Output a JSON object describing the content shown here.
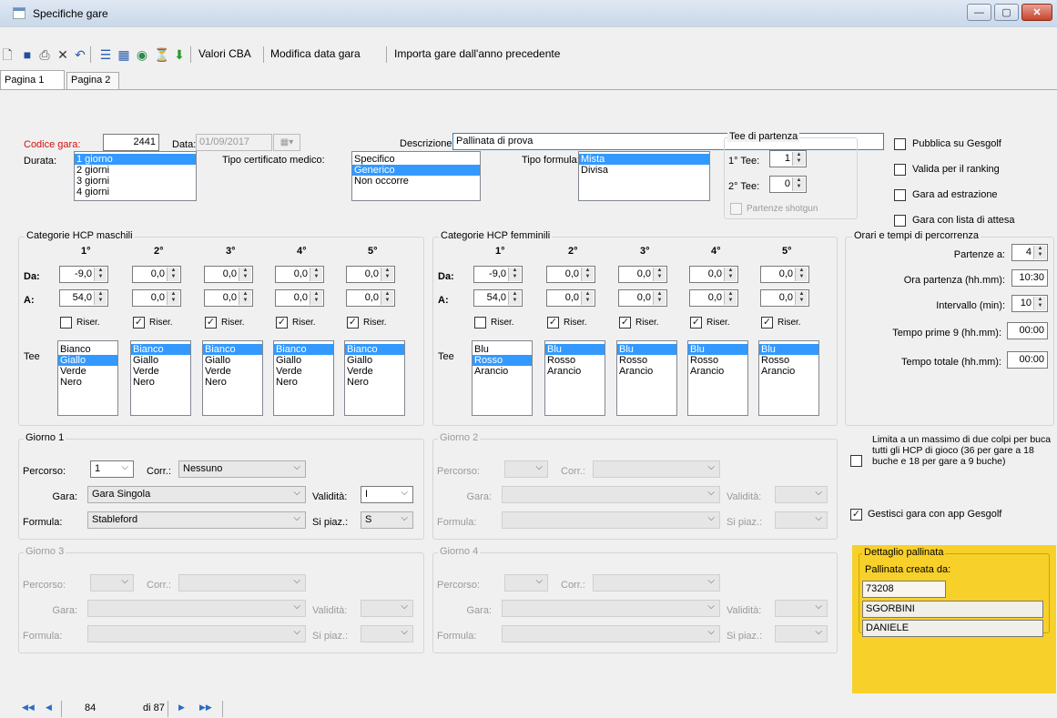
{
  "window": {
    "title": "Specifiche gare",
    "btn_min": "—",
    "btn_max": "▢",
    "btn_close": "✕"
  },
  "toolbar": {
    "valori": "Valori CBA",
    "modifica": "Modifica data gara",
    "importa": "Importa gare dall'anno precedente"
  },
  "tabs": [
    "Pagina 1",
    "Pagina 2"
  ],
  "fields": {
    "codice_label": "Codice gara:",
    "codice": "2441",
    "data_label": "Data:",
    "data": "01/09/2017",
    "descr_label": "Descrizione:",
    "descr": "Pallinata di prova",
    "durata_label": "Durata:",
    "durata": [
      "1 giorno",
      "2 giorni",
      "3 giorni",
      "4 giorni"
    ],
    "cert_label": "Tipo certificato medico:",
    "cert": [
      "Specifico",
      "Generico",
      "Non occorre"
    ],
    "formula_label": "Tipo formula:",
    "formula": [
      "Mista",
      "Divisa"
    ]
  },
  "tee_partenza": {
    "title": "Tee  di partenza",
    "t1_label": "1° Tee:",
    "t1": "1",
    "t2_label": "2° Tee:",
    "t2": "0",
    "shotgun": "Partenze shotgun"
  },
  "checks": {
    "pubblica": "Pubblica su Gesgolf",
    "ranking": "Valida per il ranking",
    "estrazione": "Gara ad estrazione",
    "attesa": "Gara con lista di attesa"
  },
  "hcp": {
    "da": "Da:",
    "a": "A:",
    "tee": "Tee",
    "riser": "Riser.",
    "heads": [
      "1°",
      "2°",
      "3°",
      "4°",
      "5°"
    ],
    "maschili": {
      "title": "Categorie HCP maschili",
      "da": [
        "-9,0",
        "0,0",
        "0,0",
        "0,0",
        "0,0"
      ],
      "a": [
        "54,0",
        "0,0",
        "0,0",
        "0,0",
        "0,0"
      ],
      "tees": [
        "Bianco",
        "Giallo",
        "Verde",
        "Nero"
      ],
      "sel": [
        1,
        0,
        0,
        0,
        0
      ]
    },
    "femminili": {
      "title": "Categorie HCP femminili",
      "da": [
        "-9,0",
        "0,0",
        "0,0",
        "0,0",
        "0,0"
      ],
      "a": [
        "54,0",
        "0,0",
        "0,0",
        "0,0",
        "0,0"
      ],
      "tees": [
        "Blu",
        "Rosso",
        "Arancio"
      ],
      "sel": [
        1,
        0,
        0,
        0,
        0
      ]
    }
  },
  "orari": {
    "title": "Orari e tempi di percorrenza",
    "partenze_label": "Partenze a:",
    "partenze": "4",
    "ora_label": "Ora partenza (hh.mm):",
    "ora": "10:30",
    "int_label": "Intervallo (min):",
    "int": "10",
    "t9_label": "Tempo prime 9 (hh.mm):",
    "t9": "00:00",
    "tt_label": "Tempo totale (hh.mm):",
    "tt": "00:00"
  },
  "giorni": {
    "g1": "Giorno 1",
    "g2": "Giorno 2",
    "g3": "Giorno 3",
    "g4": "Giorno 4",
    "percorso": "Percorso:",
    "corr": "Corr.:",
    "gara": "Gara:",
    "formula": "Formula:",
    "validita": "Validità:",
    "spiaz": "Si piaz.:",
    "g1v": {
      "percorso": "1",
      "corr": "Nessuno",
      "gara": "Gara Singola",
      "formula": "Stableford",
      "validita": "I",
      "spiaz": "S"
    }
  },
  "limita": "Limita a un massimo di due colpi per buca tutti gli HCP di gioco (36 per gare a 18 buche e 18 per gare a 9 buche)",
  "gestisci": "Gestisci gara con app Gesgolf",
  "dettaglio": {
    "title": "Dettaglio pallinata",
    "creata": "Pallinata creata da:",
    "id": "73208",
    "cognome": "SGORBINI",
    "nome": "DANIELE"
  },
  "nav": {
    "first": "◀◀",
    "prev": "◀",
    "pos": "84",
    "total": "di 87",
    "next": "▶",
    "last": "▶▶"
  }
}
